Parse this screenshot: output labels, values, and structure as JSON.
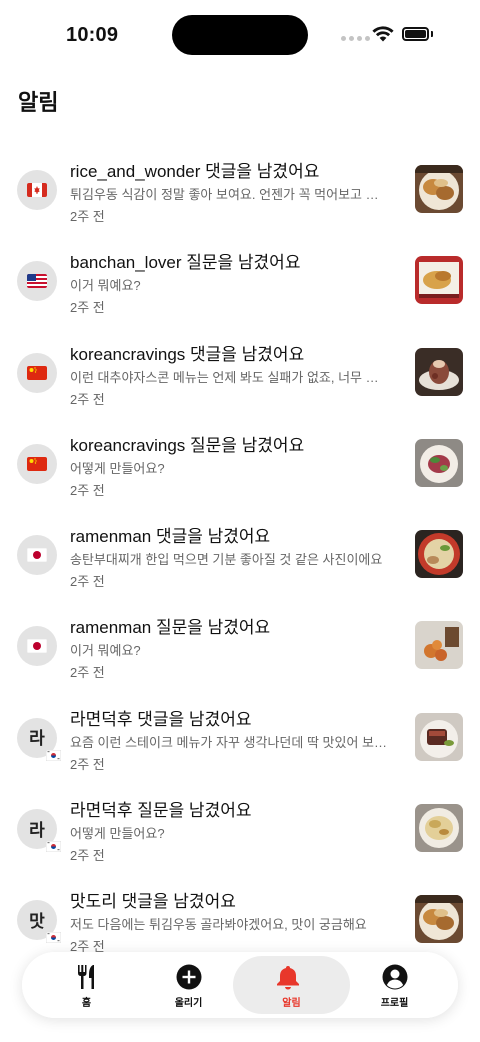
{
  "status_bar": {
    "time": "10:09"
  },
  "page": {
    "title": "알림"
  },
  "notifications": [
    {
      "title": "rice_and_wonder 댓글을 남겼어요",
      "message": "튀김우동 식감이 정말 좋아 보여요. 언젠가 꼭 먹어보고 싶어요!",
      "time": "2주 전",
      "avatar": "flag-canada-icon"
    },
    {
      "title": "banchan_lover 질문을 남겼어요",
      "message": "이거 뭐예요?",
      "time": "2주 전",
      "avatar": "flag-usa-icon"
    },
    {
      "title": "koreancravings 댓글을 남겼어요",
      "message": "이런 대추야자스콘 메뉴는 언제 봐도 실패가 없죠, 너무 맛있어 보여요",
      "time": "2주 전",
      "avatar": "flag-china-icon"
    },
    {
      "title": "koreancravings 질문을 남겼어요",
      "message": "어떻게 만들어요?",
      "time": "2주 전",
      "avatar": "flag-china-icon"
    },
    {
      "title": "ramenman 댓글을 남겼어요",
      "message": "송탄부대찌개 한입 먹으면 기분 좋아질 것 같은 사진이에요",
      "time": "2주 전",
      "avatar": "flag-japan-icon"
    },
    {
      "title": "ramenman 질문을 남겼어요",
      "message": "이거 뭐예요?",
      "time": "2주 전",
      "avatar": "flag-japan-icon"
    },
    {
      "title": "라면덕후 댓글을 남겼어요",
      "message": "요즘 이런 스테이크 메뉴가 자꾸 생각나던데 딱 맛있어 보여요",
      "time": "2주 전",
      "avatar_char": "라"
    },
    {
      "title": "라면덕후 질문을 남겼어요",
      "message": "어떻게 만들어요?",
      "time": "2주 전",
      "avatar_char": "라"
    },
    {
      "title": "맛도리 댓글을 남겼어요",
      "message": "저도 다음에는 튀김우동 골라봐야겠어요, 맛이 궁금해요",
      "time": "2주 전",
      "avatar_char": "맛"
    }
  ],
  "tabs": [
    {
      "label": "홈",
      "icon": "fork-knife-icon"
    },
    {
      "label": "올리기",
      "icon": "plus-circle-icon"
    },
    {
      "label": "알림",
      "icon": "bell-icon",
      "active": true
    },
    {
      "label": "프로필",
      "icon": "profile-icon"
    }
  ],
  "colors": {
    "accent": "#e8372b",
    "muted_text": "#666666",
    "avatar_bg": "#e3e3e3"
  }
}
